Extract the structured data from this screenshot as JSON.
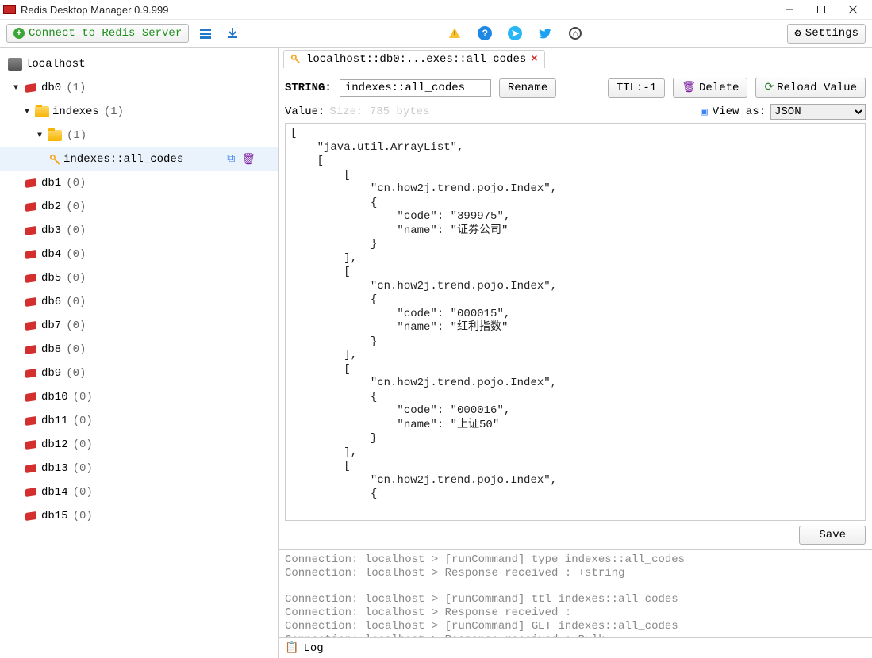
{
  "window": {
    "title": "Redis Desktop Manager 0.9.999"
  },
  "toolbar": {
    "connect_label": "Connect to Redis Server",
    "settings_label": "Settings"
  },
  "sidebar": {
    "server": "localhost",
    "db0": {
      "name": "db0",
      "count": "(1)"
    },
    "indexes": {
      "name": "indexes",
      "count": "(1)"
    },
    "folder2": {
      "name": "",
      "count": "(1)"
    },
    "key": "indexes::all_codes",
    "dbs": [
      {
        "name": "db1",
        "count": "(0)"
      },
      {
        "name": "db2",
        "count": "(0)"
      },
      {
        "name": "db3",
        "count": "(0)"
      },
      {
        "name": "db4",
        "count": "(0)"
      },
      {
        "name": "db5",
        "count": "(0)"
      },
      {
        "name": "db6",
        "count": "(0)"
      },
      {
        "name": "db7",
        "count": "(0)"
      },
      {
        "name": "db8",
        "count": "(0)"
      },
      {
        "name": "db9",
        "count": "(0)"
      },
      {
        "name": "db10",
        "count": "(0)"
      },
      {
        "name": "db11",
        "count": "(0)"
      },
      {
        "name": "db12",
        "count": "(0)"
      },
      {
        "name": "db13",
        "count": "(0)"
      },
      {
        "name": "db14",
        "count": "(0)"
      },
      {
        "name": "db15",
        "count": "(0)"
      }
    ]
  },
  "tab": {
    "label": "localhost::db0:...exes::all_codes"
  },
  "key_editor": {
    "type_label": "STRING:",
    "key_value": "indexes::all_codes",
    "rename_label": "Rename",
    "ttl_label": "TTL:-1",
    "delete_label": "Delete",
    "reload_label": "Reload Value",
    "value_label": "Value:",
    "size_label": "Size: 785 bytes",
    "view_as_label": "View as:",
    "view_as_value": "JSON",
    "save_label": "Save",
    "code": "[\n    \"java.util.ArrayList\",\n    [\n        [\n            \"cn.how2j.trend.pojo.Index\",\n            {\n                \"code\": \"399975\",\n                \"name\": \"证券公司\"\n            }\n        ],\n        [\n            \"cn.how2j.trend.pojo.Index\",\n            {\n                \"code\": \"000015\",\n                \"name\": \"红利指数\"\n            }\n        ],\n        [\n            \"cn.how2j.trend.pojo.Index\",\n            {\n                \"code\": \"000016\",\n                \"name\": \"上证50\"\n            }\n        ],\n        [\n            \"cn.how2j.trend.pojo.Index\",\n            {"
  },
  "log": {
    "lines": "Connection: localhost > [runCommand] type indexes::all_codes\nConnection: localhost > Response received : +string\n\nConnection: localhost > [runCommand] ttl indexes::all_codes\nConnection: localhost > Response received :\nConnection: localhost > [runCommand] GET indexes::all_codes\nConnection: localhost > Response received : Bulk",
    "tab_label": "Log"
  }
}
